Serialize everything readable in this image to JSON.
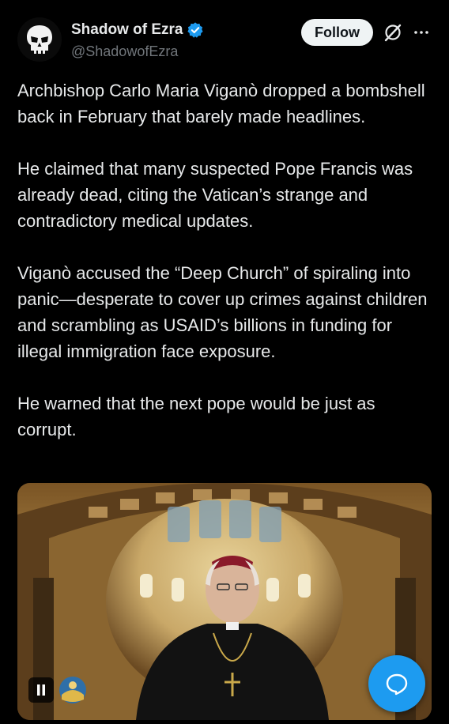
{
  "author": {
    "display_name": "Shadow of Ezra",
    "handle": "@ShadowofEzra",
    "avatar_icon": "skull-icon",
    "verified": true
  },
  "actions": {
    "follow_label": "Follow",
    "grok_icon": "grok-icon",
    "more_icon": "more-dots-icon"
  },
  "tweet": {
    "paragraphs": [
      "Archbishop Carlo Maria Viganò dropped a bombshell back in February that barely made headlines.",
      "He claimed that many suspected Pope Francis was already dead, citing the Vatican’s strange and contradictory medical updates.",
      "Viganò accused the “Deep Church” of spiraling into panic—desperate to cover up crimes against children and scrambling as USAID’s billions in funding for illegal immigration face exposure.",
      "He warned that the next pope would be just as corrupt."
    ]
  },
  "media": {
    "type": "video",
    "playback_state": "playing",
    "pause_icon": "pause-icon",
    "channel_logo_icon": "channel-logo-icon"
  },
  "fab": {
    "icon": "reply-bubble-icon",
    "color": "#1d9bf0"
  },
  "colors": {
    "background": "#000000",
    "text": "#e7e9ea",
    "secondary": "#71767b",
    "accent": "#1d9bf0"
  }
}
